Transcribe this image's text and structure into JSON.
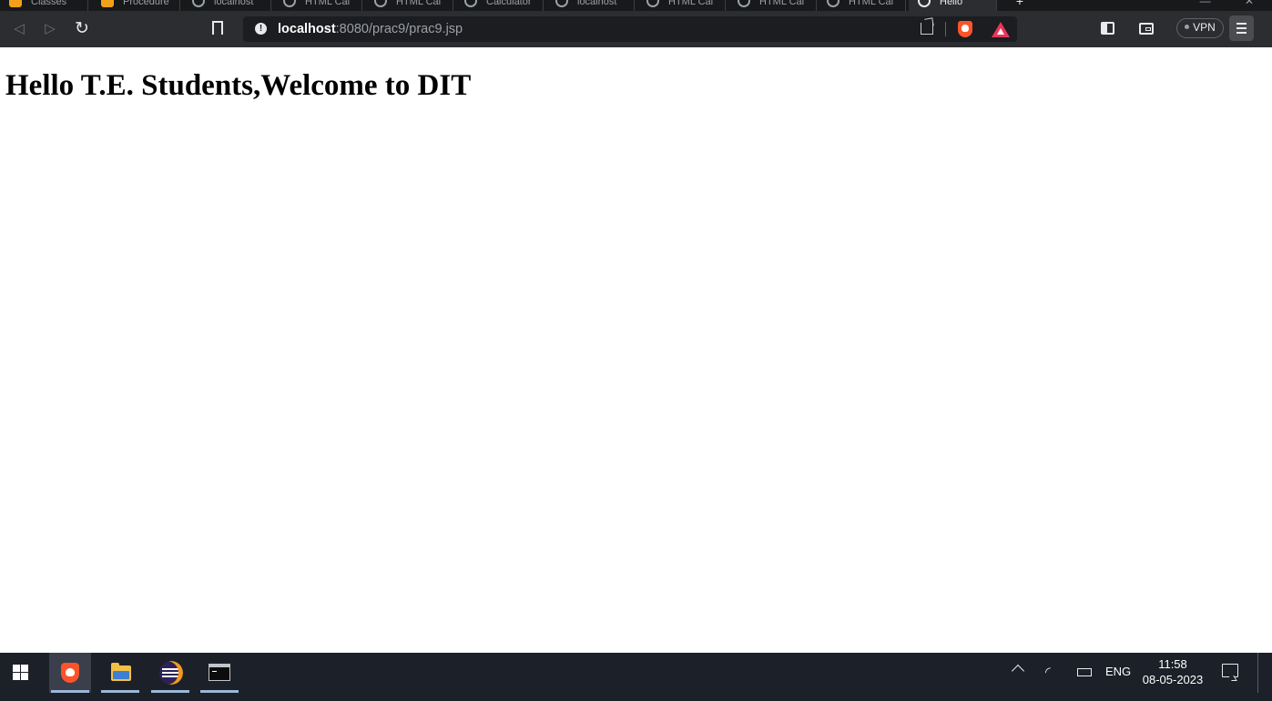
{
  "browser": {
    "tabs": [
      {
        "label": "Classes",
        "icon": "orange-app-icon"
      },
      {
        "label": "Procedure",
        "icon": "orange-app-icon"
      },
      {
        "label": "localhost",
        "icon": "globe-icon"
      },
      {
        "label": "HTML Cal",
        "icon": "globe-icon"
      },
      {
        "label": "HTML Cal",
        "icon": "globe-icon"
      },
      {
        "label": "Calculator",
        "icon": "globe-icon"
      },
      {
        "label": "localhost",
        "icon": "globe-icon"
      },
      {
        "label": "HTML Cal",
        "icon": "globe-icon"
      },
      {
        "label": "HTML Cal",
        "icon": "globe-icon"
      },
      {
        "label": "HTML Cal",
        "icon": "globe-icon"
      },
      {
        "label": "Hello",
        "icon": "globe-icon",
        "active": true
      }
    ],
    "new_tab_label": "+",
    "url": {
      "host": "localhost",
      "rest": ":8080/prac9/prac9.jsp"
    },
    "vpn_label": "VPN",
    "colors": {
      "chrome_bg": "#2b2d31",
      "brave_orange": "#fb542b",
      "rewards_red": "#e8355a"
    }
  },
  "page": {
    "heading": "Hello T.E. Students,Welcome to DIT"
  },
  "taskbar": {
    "apps": [
      "windows-start-icon",
      "brave-icon",
      "file-explorer-icon",
      "eclipse-icon",
      "command-prompt-icon"
    ],
    "language": "ENG",
    "time": "11:58",
    "date": "08-05-2023"
  }
}
